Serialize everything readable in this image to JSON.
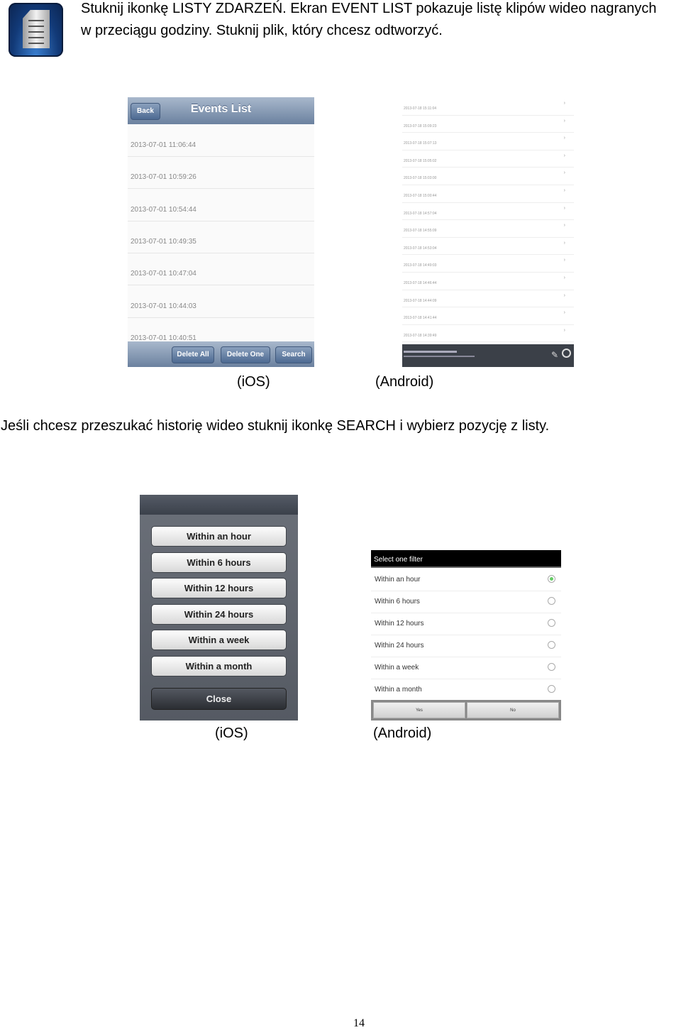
{
  "intro": {
    "line1": "Stuknij ikonkę LISTY ZDARZEŃ. Ekran EVENT LIST pokazuje listę klipów wideo nagranych",
    "line2": "w przeciągu godziny. Stuknij plik, który chcesz odtworzyć.",
    "icon": "event-list-document-icon"
  },
  "ios_events": {
    "back": "Back",
    "title": "Events List",
    "rows": [
      "2013-07-01 11:06:44",
      "2013-07-01 10:59:26",
      "2013-07-01 10:54:44",
      "2013-07-01 10:49:35",
      "2013-07-01 10:47:04",
      "2013-07-01 10:44:03",
      "2013-07-01 10:40:51"
    ],
    "delete_all": "Delete All",
    "delete_one": "Delete One",
    "search": "Search"
  },
  "android_events": {
    "rows": [
      "2013-07-18 15:11:04",
      "2013-07-18 15:09:23",
      "2013-07-18 15:07:13",
      "2013-07-18 15:05:02",
      "2013-07-18 15:03:00",
      "2013-07-18 15:00:44",
      "2013-07-18 14:57:04",
      "2013-07-18 14:55:09",
      "2013-07-18 14:53:04",
      "2013-07-18 14:49:03",
      "2013-07-18 14:46:44",
      "2013-07-18 14:44:09",
      "2013-07-18 14:41:44",
      "2013-07-18 14:39:49"
    ],
    "icons": [
      "pencil-icon",
      "search-icon"
    ]
  },
  "captions": {
    "ios": "(iOS)",
    "android": "(Android)"
  },
  "search_text": "Jeśli chcesz przeszukać historię wideo stuknij ikonkę SEARCH i wybierz pozycję z listy.",
  "ios_filter": {
    "options": [
      "Within an hour",
      "Within 6 hours",
      "Within 12 hours",
      "Within 24 hours",
      "Within a week",
      "Within a month"
    ],
    "close": "Close"
  },
  "android_filter": {
    "title": "Select one filter",
    "options": [
      "Within an hour",
      "Within 6 hours",
      "Within 12 hours",
      "Within 24 hours",
      "Within a week",
      "Within a month"
    ],
    "selected": "Within an hour",
    "yes": "Yes",
    "no": "No"
  },
  "page_number": "14"
}
